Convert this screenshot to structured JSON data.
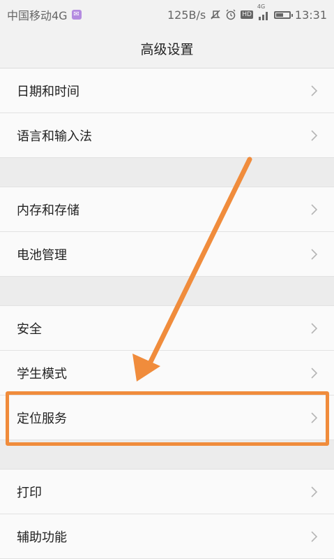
{
  "status_bar": {
    "carrier": "中国移动4G",
    "network_speed": "125B/s",
    "signal_label": "4G",
    "hd_label": "HD",
    "time": "13:31",
    "icons": [
      "sim-icon",
      "mute-icon",
      "alarm-icon",
      "hd-icon",
      "signal-icon",
      "battery-icon"
    ],
    "battery_level": 0.5
  },
  "header": {
    "title": "高级设置"
  },
  "groups": [
    {
      "items": [
        {
          "label": "日期和时间"
        },
        {
          "label": "语言和输入法"
        }
      ]
    },
    {
      "items": [
        {
          "label": "内存和存储"
        },
        {
          "label": "电池管理"
        }
      ]
    },
    {
      "items": [
        {
          "label": "安全"
        },
        {
          "label": "学生模式"
        },
        {
          "label": "定位服务"
        }
      ]
    },
    {
      "items": [
        {
          "label": "打印"
        },
        {
          "label": "辅助功能"
        }
      ]
    }
  ],
  "annotation": {
    "highlighted_item": "定位服务",
    "color": "#f08c3c"
  },
  "colors": {
    "background": "#f2f2f2",
    "row": "#fafafa",
    "divider": "#e2e2e2",
    "chevron": "#b5b5b5",
    "sim_badge": "#b48be0"
  }
}
